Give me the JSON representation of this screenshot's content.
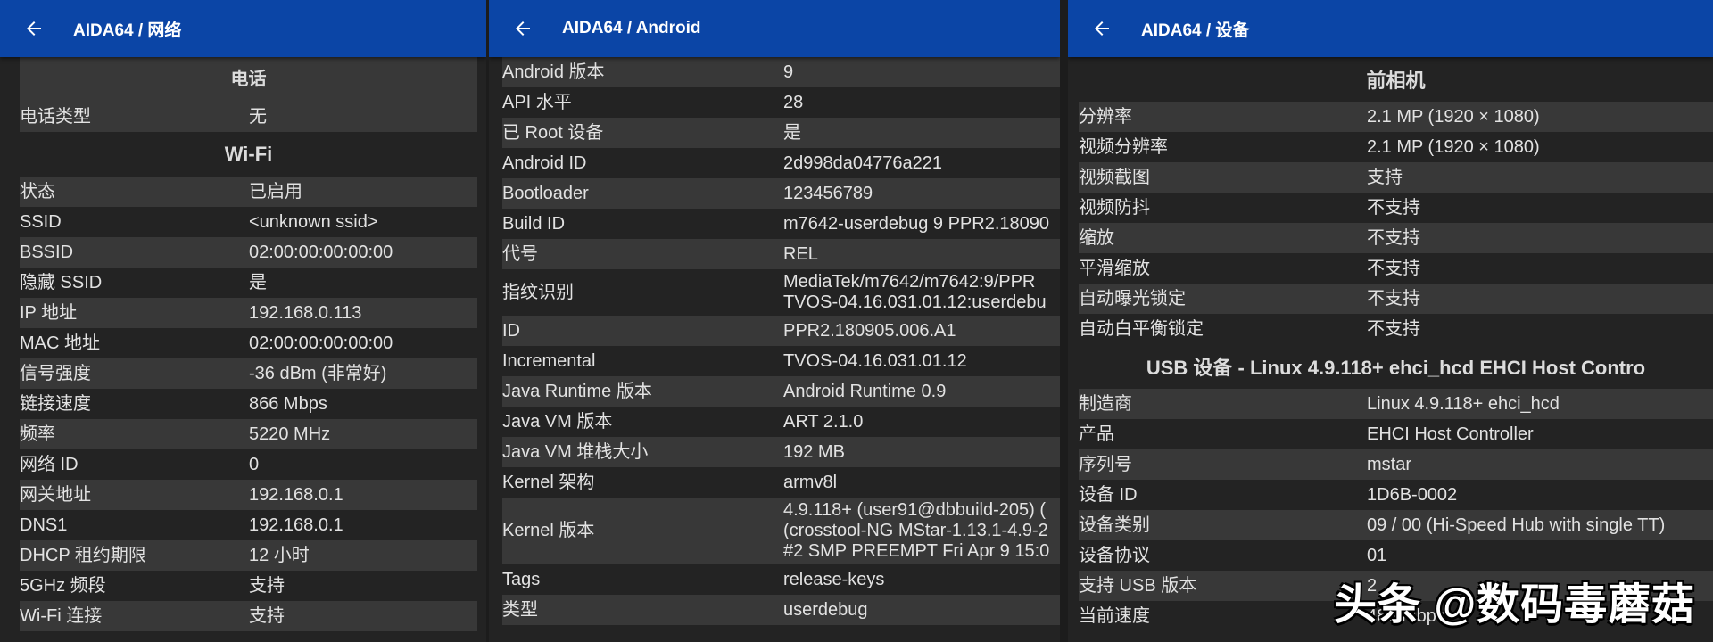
{
  "panels": [
    {
      "title": "AIDA64 / 网络",
      "blocks": [
        {
          "section": "电话"
        },
        {
          "rows": [
            [
              "电话类型",
              "无"
            ]
          ]
        },
        {
          "section": "Wi-Fi"
        },
        {
          "rows": [
            [
              "状态",
              "已启用"
            ],
            [
              "SSID",
              "<unknown ssid>"
            ],
            [
              "BSSID",
              "02:00:00:00:00:00"
            ],
            [
              "隐藏 SSID",
              "是"
            ],
            [
              "IP 地址",
              "192.168.0.113"
            ],
            [
              "MAC 地址",
              "02:00:00:00:00:00"
            ],
            [
              "信号强度",
              "-36 dBm (非常好)"
            ],
            [
              "链接速度",
              "866 Mbps"
            ],
            [
              "频率",
              "5220 MHz"
            ],
            [
              "网络 ID",
              "0"
            ],
            [
              "网关地址",
              "192.168.0.1"
            ],
            [
              "DNS1",
              "192.168.0.1"
            ],
            [
              "DHCP 租约期限",
              "12 小时"
            ],
            [
              "5GHz 频段",
              "支持"
            ],
            [
              "Wi-Fi 连接",
              "支持"
            ]
          ]
        }
      ]
    },
    {
      "title": "AIDA64 / Android",
      "blocks": [
        {
          "rows": [
            [
              "Android 版本",
              "9"
            ],
            [
              "API 水平",
              "28"
            ],
            [
              "已 Root 设备",
              "是"
            ],
            [
              "Android ID",
              "2d998da04776a221"
            ],
            [
              "Bootloader",
              "123456789"
            ],
            [
              "Build ID",
              "m7642-userdebug 9 PPR2.18090"
            ],
            [
              "代号",
              "REL"
            ],
            [
              "指纹识别",
              "MediaTek/m7642/m7642:9/PPR\nTVOS-04.16.031.01.12:userdebu"
            ],
            [
              "ID",
              "PPR2.180905.006.A1"
            ],
            [
              "Incremental",
              "TVOS-04.16.031.01.12"
            ],
            [
              "Java Runtime 版本",
              "Android Runtime 0.9"
            ],
            [
              "Java VM 版本",
              "ART 2.1.0"
            ],
            [
              "Java VM 堆栈大小",
              "192 MB"
            ],
            [
              "Kernel 架构",
              "armv8l"
            ],
            [
              "Kernel 版本",
              "4.9.118+ (user91@dbbuild-205) (\n(crosstool-NG MStar-1.13.1-4.9-2\n#2 SMP PREEMPT Fri Apr 9 15:0"
            ],
            [
              "Tags",
              "release-keys"
            ],
            [
              "类型",
              "userdebug"
            ]
          ]
        }
      ]
    },
    {
      "title": "AIDA64 / 设备",
      "blocks": [
        {
          "section": "前相机"
        },
        {
          "rows": [
            [
              "分辨率",
              "2.1 MP (1920 × 1080)"
            ],
            [
              "视频分辨率",
              "2.1 MP (1920 × 1080)"
            ],
            [
              "视频截图",
              "支持"
            ],
            [
              "视频防抖",
              "不支持"
            ],
            [
              "缩放",
              "不支持"
            ],
            [
              "平滑缩放",
              "不支持"
            ],
            [
              "自动曝光锁定",
              "不支持"
            ],
            [
              "自动白平衡锁定",
              "不支持"
            ]
          ]
        },
        {
          "section": "USB 设备 - Linux 4.9.118+ ehci_hcd EHCI Host Contro"
        },
        {
          "rows": [
            [
              "制造商",
              "Linux 4.9.118+ ehci_hcd"
            ],
            [
              "产品",
              "EHCI Host Controller"
            ],
            [
              "序列号",
              "mstar"
            ],
            [
              "设备 ID",
              "1D6B-0002"
            ],
            [
              "设备类别",
              "09 / 00 (Hi-Speed Hub with single TT)"
            ],
            [
              "设备协议",
              "01"
            ],
            [
              "支持 USB 版本",
              "2"
            ],
            [
              "当前速度",
              "480 Mbps"
            ]
          ]
        }
      ]
    }
  ],
  "watermark": "头条 @数码毒蘑菇",
  "colors": {
    "appbar": "#0b45a6",
    "background": "#232323",
    "row_alt": "#383838",
    "text": "#e2e2e2"
  }
}
